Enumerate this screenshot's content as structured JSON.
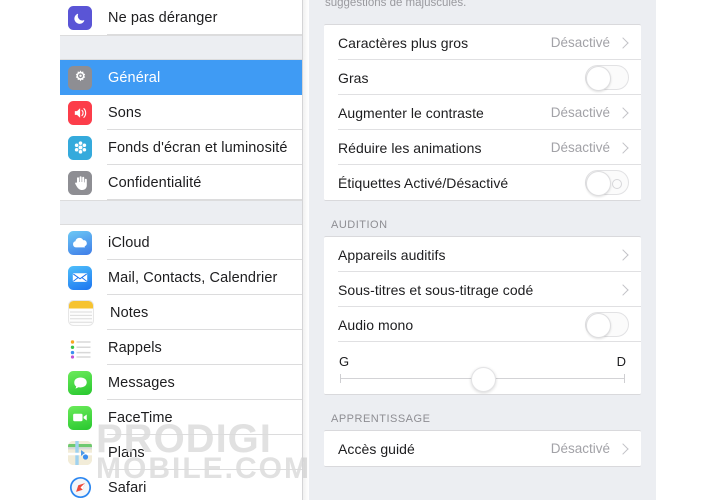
{
  "sidebar": {
    "groups": [
      {
        "items": [
          {
            "label": "Ne pas déranger",
            "icon": "moon-icon",
            "color": "#5a55d6",
            "selected": false
          }
        ]
      },
      {
        "items": [
          {
            "label": "Général",
            "icon": "gear-icon",
            "color": "#8e8e93",
            "selected": true
          },
          {
            "label": "Sons",
            "icon": "speaker-icon",
            "color": "#fc3d4a",
            "selected": false
          },
          {
            "label": "Fonds d'écran et luminosité",
            "icon": "wallpaper-icon",
            "color": "#35aadc",
            "selected": false
          },
          {
            "label": "Confidentialité",
            "icon": "hand-icon",
            "color": "#8e8e93",
            "selected": false
          }
        ]
      },
      {
        "items": [
          {
            "label": "iCloud",
            "icon": "icloud-icon",
            "color": "#3b8ff0",
            "selected": false
          },
          {
            "label": "Mail, Contacts, Calendrier",
            "icon": "mail-icon",
            "color": "#1d8ef6",
            "selected": false
          },
          {
            "label": "Notes",
            "icon": "notes-icon",
            "color": "#f8c62d",
            "selected": false
          },
          {
            "label": "Rappels",
            "icon": "reminders-icon",
            "color": "#ffffff",
            "selected": false
          },
          {
            "label": "Messages",
            "icon": "messages-icon",
            "color": "#41d746",
            "selected": false
          },
          {
            "label": "FaceTime",
            "icon": "facetime-icon",
            "color": "#41d746",
            "selected": false
          },
          {
            "label": "Plans",
            "icon": "maps-icon",
            "color": "#e8cf6a",
            "selected": false
          },
          {
            "label": "Safari",
            "icon": "safari-icon",
            "color": "#2b7df0",
            "selected": false
          }
        ]
      }
    ]
  },
  "detail": {
    "footnote": "suggestions de majuscules.",
    "vision_group": {
      "rows": [
        {
          "title": "Caractères plus gros",
          "value": "Désactivé",
          "control": "chevron"
        },
        {
          "title": "Gras",
          "value": "",
          "control": "toggle-off"
        },
        {
          "title": "Augmenter le contraste",
          "value": "Désactivé",
          "control": "chevron"
        },
        {
          "title": "Réduire les animations",
          "value": "Désactivé",
          "control": "chevron"
        },
        {
          "title": "Étiquettes Activé/Désactivé",
          "value": "",
          "control": "toggle-off-labeled"
        }
      ]
    },
    "audition": {
      "header": "AUDITION",
      "rows": [
        {
          "title": "Appareils auditifs",
          "value": "",
          "control": "chevron"
        },
        {
          "title": "Sous-titres et sous-titrage codé",
          "value": "",
          "control": "chevron"
        },
        {
          "title": "Audio mono",
          "value": "",
          "control": "toggle-off"
        }
      ],
      "balance_slider": {
        "left_label": "G",
        "right_label": "D",
        "value_percent": 50
      }
    },
    "apprentissage": {
      "header": "APPRENTISSAGE",
      "rows": [
        {
          "title": "Accès guidé",
          "value": "Désactivé",
          "control": "chevron"
        }
      ]
    }
  },
  "watermark": {
    "line1": "PRODIGI",
    "line2": "MOBILE.COM"
  },
  "colors": {
    "selection_blue": "#3f9bf4",
    "panel_background": "#eceef2",
    "card_white": "#ffffff",
    "secondary_text": "#8e8e93"
  }
}
